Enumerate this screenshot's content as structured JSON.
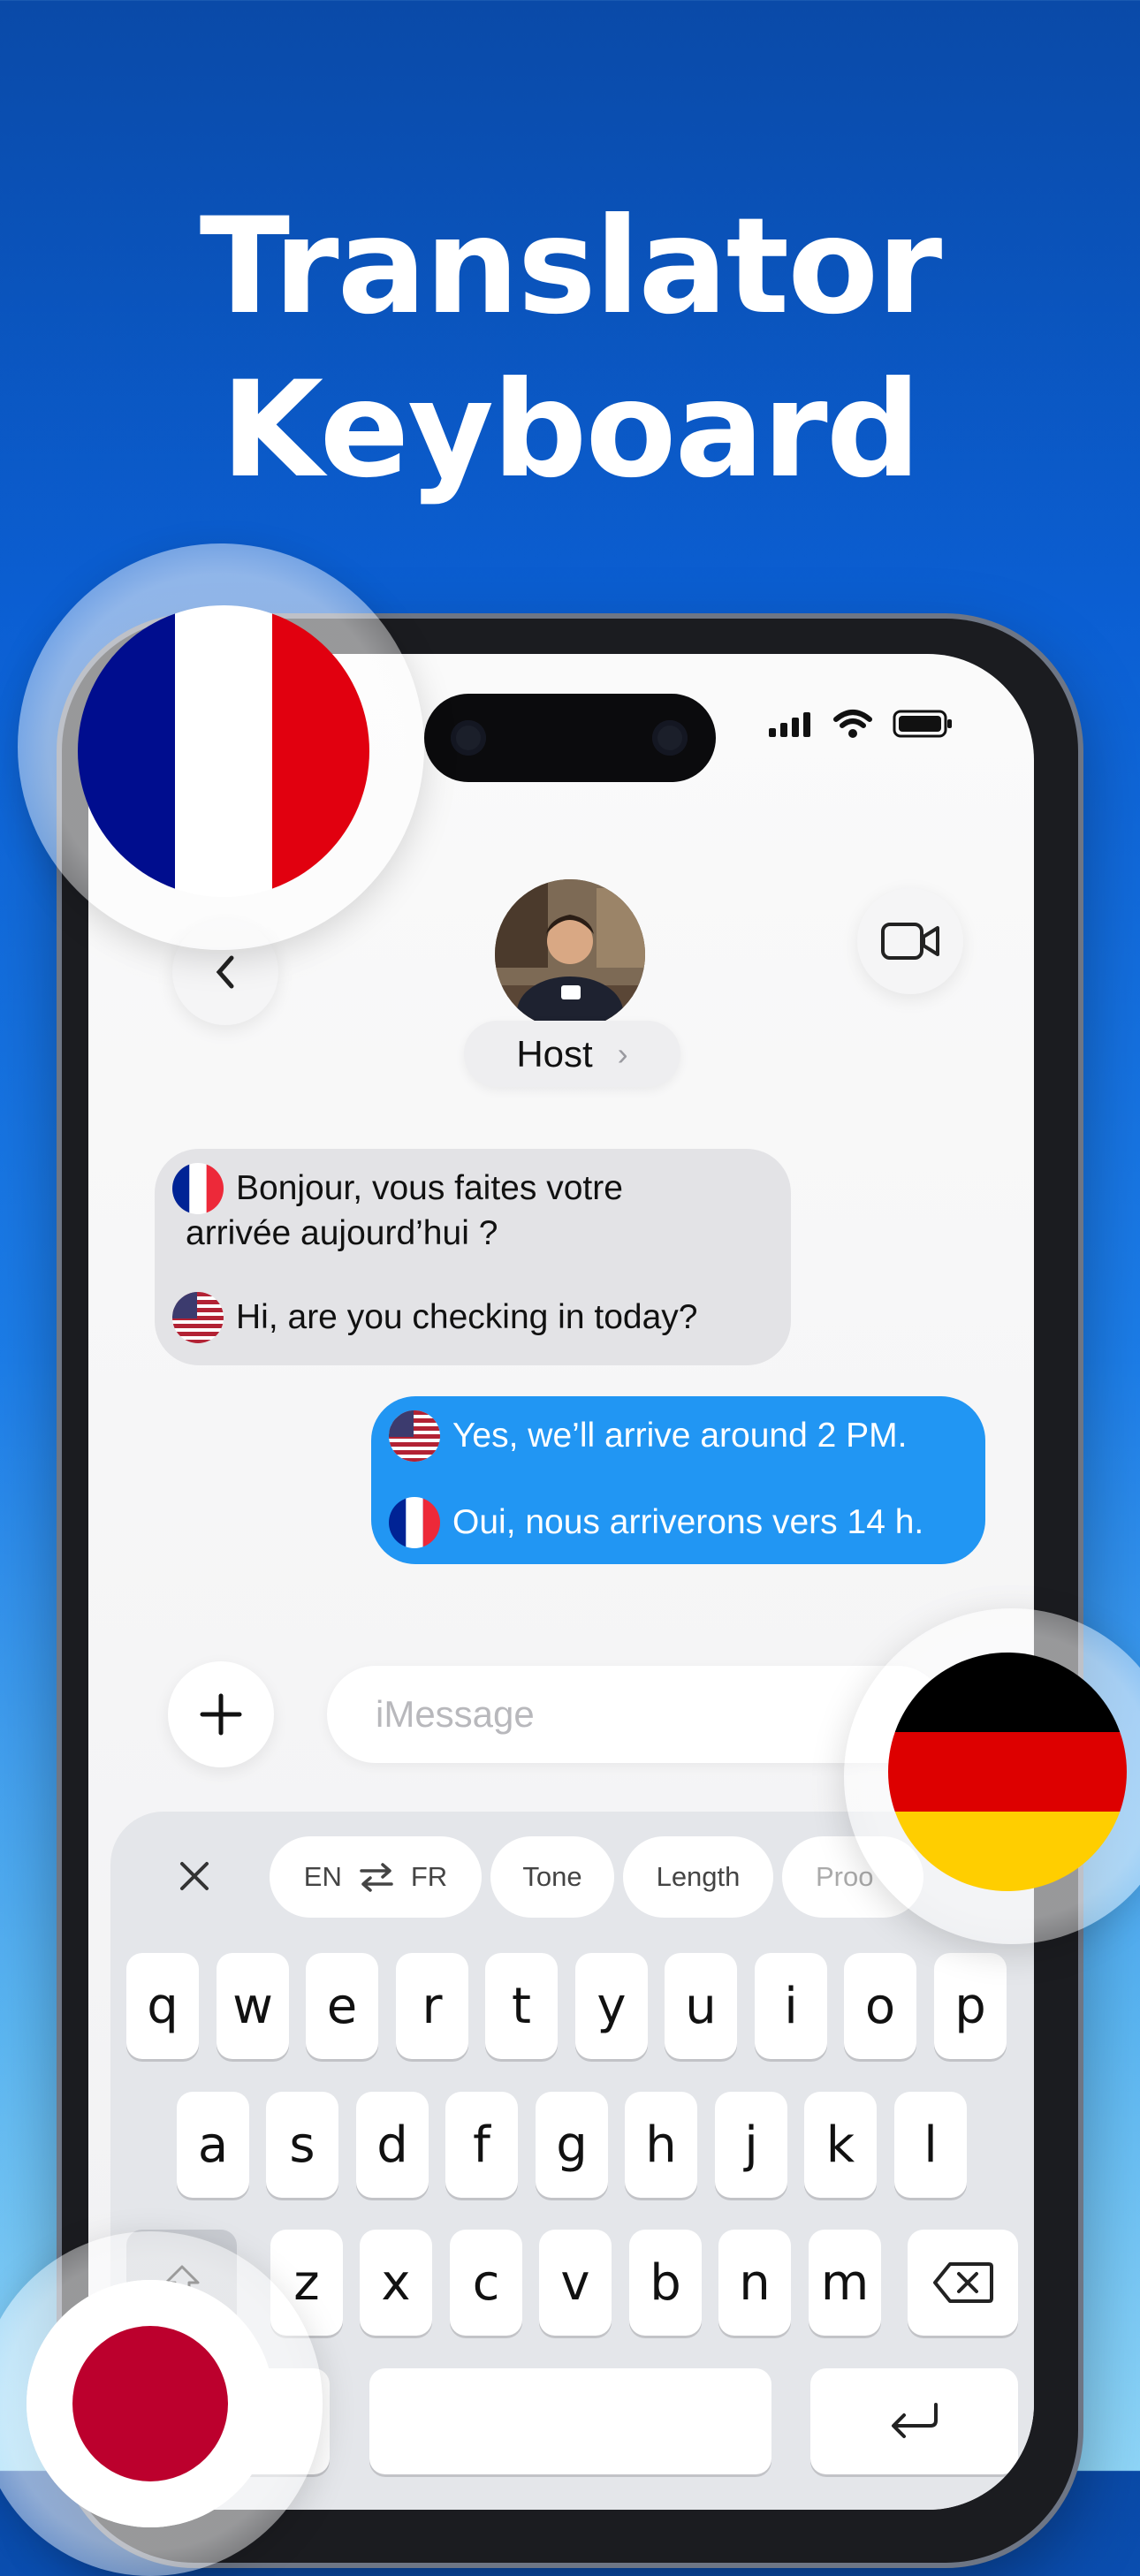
{
  "headline": {
    "line1": "Translator",
    "line2": "Keyboard"
  },
  "chat": {
    "contact_name": "Host",
    "incoming": {
      "original": "Bonjour, vous faites votre",
      "original_cont": "arrivée aujourd’hui ?",
      "translation": "Hi, are you checking in today?"
    },
    "outgoing": {
      "original": "Yes, we’ll arrive around 2 PM.",
      "translation": "Oui, nous arriverons vers 14 h."
    },
    "input_placeholder": "iMessage"
  },
  "keyboard_toolbar": {
    "source_lang": "EN",
    "target_lang": "FR",
    "swap_icon": "swap-arrows-icon",
    "chips": [
      "Tone",
      "Length",
      "Proo"
    ]
  },
  "keys": {
    "row1": [
      "q",
      "w",
      "e",
      "r",
      "t",
      "y",
      "u",
      "i",
      "o",
      "p"
    ],
    "row2": [
      "a",
      "s",
      "d",
      "f",
      "g",
      "h",
      "j",
      "k",
      "l"
    ],
    "row3": [
      "z",
      "x",
      "c",
      "v",
      "b",
      "n",
      "m"
    ]
  },
  "colors": {
    "outgoing_bubble": "#2196f3",
    "incoming_bubble": "#e3e3e6",
    "background_top": "#0a4aa8",
    "background_bottom": "#8fd6f8"
  },
  "icons": [
    "back-chevron-icon",
    "video-camera-icon",
    "signal-icon",
    "wifi-icon",
    "battery-icon",
    "plus-icon",
    "close-icon",
    "swap-arrows-icon",
    "backspace-icon",
    "return-icon"
  ]
}
